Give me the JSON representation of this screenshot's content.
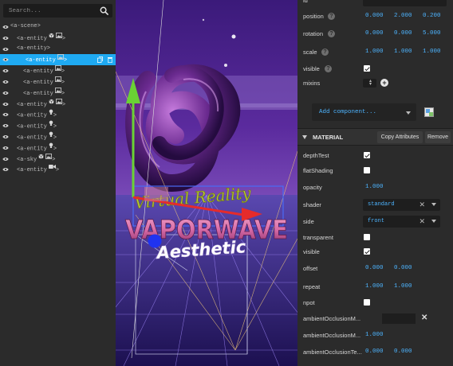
{
  "search": {
    "placeholder": "Search..."
  },
  "tree": [
    {
      "label": "<a-scene>",
      "indent": 0,
      "icons": [],
      "selected": false
    },
    {
      "label": "<a-entity",
      "indent": 1,
      "icons": [
        "cube-icon",
        "image-icon"
      ],
      "suffix": ">",
      "selected": false
    },
    {
      "label": "<a-entity>",
      "indent": 1,
      "icons": [],
      "selected": false
    },
    {
      "label": "<a-entity",
      "indent": 2,
      "icons": [
        "image-icon"
      ],
      "suffix": ">",
      "selected": true
    },
    {
      "label": "<a-entity",
      "indent": 2,
      "icons": [
        "image-icon"
      ],
      "suffix": ">",
      "selected": false
    },
    {
      "label": "<a-entity",
      "indent": 2,
      "icons": [
        "image-icon"
      ],
      "suffix": ">",
      "selected": false
    },
    {
      "label": "<a-entity",
      "indent": 2,
      "icons": [
        "image-icon"
      ],
      "suffix": ">",
      "selected": false
    },
    {
      "label": "<a-entity",
      "indent": 1,
      "icons": [
        "cube-icon",
        "image-icon"
      ],
      "suffix": ">",
      "selected": false
    },
    {
      "label": "<a-entity",
      "indent": 1,
      "icons": [
        "light-icon"
      ],
      "suffix": ">",
      "selected": false
    },
    {
      "label": "<a-entity",
      "indent": 1,
      "icons": [
        "light-icon"
      ],
      "suffix": ">",
      "selected": false
    },
    {
      "label": "<a-entity",
      "indent": 1,
      "icons": [
        "light-icon"
      ],
      "suffix": ">",
      "selected": false
    },
    {
      "label": "<a-entity",
      "indent": 1,
      "icons": [
        "light-icon"
      ],
      "suffix": ">",
      "selected": false
    },
    {
      "label": "<a-sky",
      "indent": 1,
      "icons": [
        "cube-icon",
        "image-icon"
      ],
      "suffix": ">",
      "selected": false
    },
    {
      "label": "<a-entity",
      "indent": 1,
      "icons": [
        "camera-icon"
      ],
      "suffix": ">",
      "selected": false
    }
  ],
  "viewport": {
    "sign_line1": "Virtual Reality",
    "sign_line2": "VAPORWAVE",
    "sign_line3": "Aesthetic"
  },
  "inspector": {
    "top_label": "id",
    "position": {
      "label": "position",
      "values": [
        "0.000",
        "2.000",
        "0.200"
      ]
    },
    "rotation": {
      "label": "rotation",
      "values": [
        "0.000",
        "0.000",
        "5.000"
      ]
    },
    "scale": {
      "label": "scale",
      "values": [
        "1.000",
        "1.000",
        "1.000"
      ]
    },
    "visible": {
      "label": "visible",
      "checked": true
    },
    "mixins": {
      "label": "mixins"
    },
    "add_component": "Add component...",
    "material": {
      "title": "MATERIAL",
      "copy_label": "Copy Attributes",
      "remove_label": "Remove",
      "props": [
        {
          "key": "depthTest",
          "label": "depthTest",
          "type": "check",
          "checked": true
        },
        {
          "key": "flatShading",
          "label": "flatShading",
          "type": "check",
          "checked": false
        },
        {
          "key": "opacity",
          "label": "opacity",
          "type": "num",
          "values": [
            "1.000"
          ]
        },
        {
          "key": "shader",
          "label": "shader",
          "type": "select",
          "value": "standard"
        },
        {
          "key": "side",
          "label": "side",
          "type": "select",
          "value": "front"
        },
        {
          "key": "transparent",
          "label": "transparent",
          "type": "check",
          "checked": false
        },
        {
          "key": "visible",
          "label": "visible",
          "type": "check",
          "checked": true
        },
        {
          "key": "offset",
          "label": "offset",
          "type": "num",
          "values": [
            "0.000",
            "0.000"
          ]
        },
        {
          "key": "repeat",
          "label": "repeat",
          "type": "num",
          "values": [
            "1.000",
            "1.000"
          ]
        },
        {
          "key": "npot",
          "label": "npot",
          "type": "check",
          "checked": false
        },
        {
          "key": "ambientOcclusionMap",
          "label": "ambientOcclusionM...",
          "type": "map"
        },
        {
          "key": "ambientOcclusionMapIntensity",
          "label": "ambientOcclusionM...",
          "type": "num",
          "values": [
            "1.000"
          ]
        },
        {
          "key": "ambientOcclusionTextureOffset",
          "label": "ambientOcclusionTe...",
          "type": "num",
          "values": [
            "0.000",
            "0.000"
          ]
        }
      ]
    }
  },
  "colors": {
    "selection": "#1faaf2",
    "value_blue": "#4db4ff",
    "panel_bg": "#2b2b2b"
  }
}
